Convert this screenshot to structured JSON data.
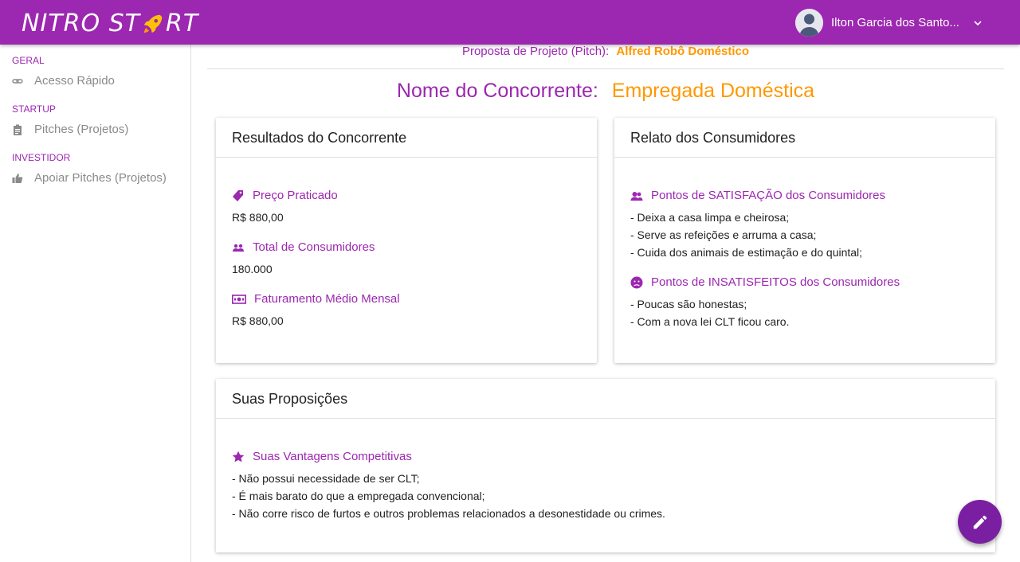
{
  "app": {
    "logo_left": "NITRO ST",
    "logo_right": "RT",
    "user_name": "Ilton Garcia dos Santo..."
  },
  "sidebar": {
    "sections": [
      {
        "title": "GERAL",
        "items": [
          {
            "label": "Acesso Rápido",
            "icon": "link-icon"
          }
        ]
      },
      {
        "title": "STARTUP",
        "items": [
          {
            "label": "Pitches (Projetos)",
            "icon": "clipboard-icon"
          }
        ]
      },
      {
        "title": "INVESTIDOR",
        "items": [
          {
            "label": "Apoiar Pitches (Projetos)",
            "icon": "thumb-up-icon"
          }
        ]
      }
    ]
  },
  "header": {
    "pitch_label": "Proposta de Projeto (Pitch):",
    "pitch_value": "Alfred Robô Doméstico",
    "competitor_label": "Nome do Concorrente:",
    "competitor_value": "Empregada Doméstica"
  },
  "results_card": {
    "title": "Resultados do Concorrente",
    "fields": [
      {
        "label": "Preço Praticado",
        "value": "R$ 880,00",
        "icon": "tag-icon"
      },
      {
        "label": "Total de Consumidores",
        "value": "180.000",
        "icon": "people-icon"
      },
      {
        "label": "Faturamento Médio Mensal",
        "value": "R$ 880,00",
        "icon": "money-icon"
      }
    ]
  },
  "consumers_card": {
    "title": "Relato dos Consumidores",
    "satisfaction_label": "Pontos de SATISFAÇÃO dos Consumidores",
    "satisfaction_items": [
      "- Deixa a casa limpa e cheirosa;",
      "- Serve as refeições e arruma a casa;",
      "- Cuida dos animais de estimação e do quintal;"
    ],
    "dissatisfaction_label": "Pontos de INSATISFEITOS dos Consumidores",
    "dissatisfaction_items": [
      "- Poucas são honestas;",
      "- Com a nova lei CLT ficou caro."
    ]
  },
  "propositions_card": {
    "title": "Suas Proposições",
    "advantages_label": "Suas Vantagens Competitivas",
    "advantages_items": [
      "- Não possui necessidade de ser CLT;",
      "- É mais barato do que a empregada convencional;",
      "- Não corre risco de furtos e outros problemas relacionados a desonestidade ou crimes."
    ]
  },
  "colors": {
    "primary": "#9c27b0",
    "accent": "#ff9800",
    "fab": "#7b1fa2"
  }
}
